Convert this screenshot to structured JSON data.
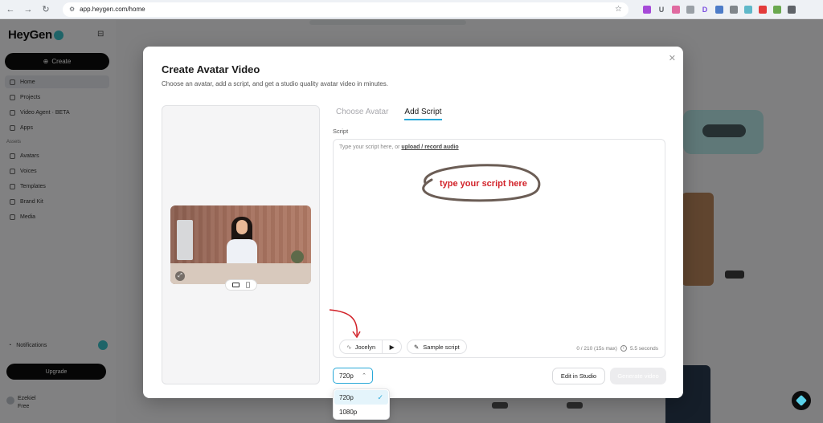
{
  "browser": {
    "url": "app.heygen.com/home",
    "extensions": [
      {
        "name": "ext-purple",
        "glyph": "",
        "color": "#a64ad8"
      },
      {
        "name": "ext-u",
        "glyph": "U",
        "color": "#5f6368"
      },
      {
        "name": "ext-pink",
        "glyph": "",
        "color": "#e06aa0"
      },
      {
        "name": "ext-grey",
        "glyph": "",
        "color": "#9aa0a6"
      },
      {
        "name": "ext-d",
        "glyph": "D",
        "color": "#7b4de0"
      },
      {
        "name": "ext-bs",
        "glyph": "",
        "color": "#4d7cc8"
      },
      {
        "name": "ext-camera",
        "glyph": "",
        "color": "#80868b"
      },
      {
        "name": "ext-heygen",
        "glyph": "",
        "color": "#5fb8c9"
      },
      {
        "name": "ext-red",
        "glyph": "",
        "color": "#e33b3b"
      },
      {
        "name": "ext-blocks",
        "glyph": "",
        "color": "#6aa84f"
      },
      {
        "name": "ext-puzzle",
        "glyph": "",
        "color": "#5f6368"
      }
    ]
  },
  "app": {
    "logo": "HeyGen",
    "create_label": "Create",
    "sidebar": [
      {
        "label": "Home"
      },
      {
        "label": "Projects"
      },
      {
        "label": "Video Agent · BETA"
      },
      {
        "label": "Apps"
      }
    ],
    "sidebar_section": "Assets",
    "sidebar_assets": [
      {
        "label": "Avatars"
      },
      {
        "label": "Voices"
      },
      {
        "label": "Templates"
      },
      {
        "label": "Brand Kit"
      },
      {
        "label": "Media"
      }
    ],
    "notifications_label": "Notifications",
    "upgrade_label": "Upgrade",
    "profile_name": "Ezekiel",
    "profile_plan": "Free"
  },
  "modal": {
    "title": "Create Avatar Video",
    "subtitle": "Choose an avatar, add a script, and get a studio quality avatar video in minutes.",
    "tabs": [
      {
        "label": "Choose Avatar",
        "active": false
      },
      {
        "label": "Add Script",
        "active": true
      }
    ],
    "script_label": "Script",
    "placeholder_prefix": "Type your script here, or ",
    "placeholder_link": "upload / record audio",
    "annotation": "type your script here",
    "voice_name": "Jocelyn",
    "sample_script_label": "Sample script",
    "counter": "0 / 210 (15s max)",
    "duration": "5.5 seconds",
    "resolution": "720p",
    "resolution_options": [
      {
        "label": "720p",
        "selected": true
      },
      {
        "label": "1080p",
        "selected": false
      }
    ],
    "edit_studio_label": "Edit in Studio",
    "generate_label": "Generate video"
  },
  "colors": {
    "accent": "#28a8d8",
    "annotation": "#d2232a",
    "primary_dark": "#0c0c0c"
  }
}
